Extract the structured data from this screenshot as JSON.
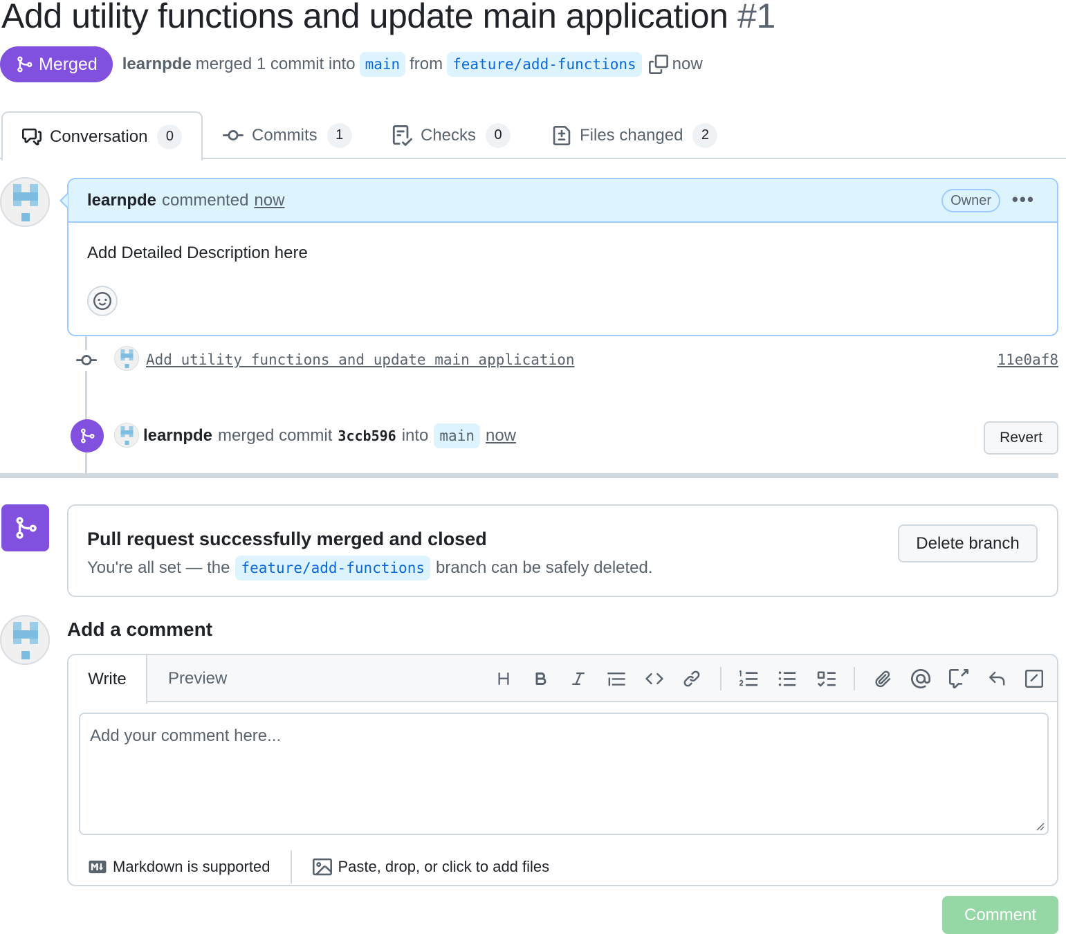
{
  "pr": {
    "title": "Add utility functions and update main application",
    "number": "#1",
    "state": "Merged",
    "author": "learnpde",
    "merged_text": "merged 1 commit into",
    "base_branch": "main",
    "from_text": "from",
    "head_branch": "feature/add-functions",
    "time": "now"
  },
  "tabs": [
    {
      "label": "Conversation",
      "count": "0",
      "icon": "comment-discussion-icon"
    },
    {
      "label": "Commits",
      "count": "1",
      "icon": "git-commit-icon"
    },
    {
      "label": "Checks",
      "count": "0",
      "icon": "checklist-icon"
    },
    {
      "label": "Files changed",
      "count": "2",
      "icon": "file-diff-icon"
    }
  ],
  "comment": {
    "author": "learnpde",
    "action": "commented",
    "time": "now",
    "badge": "Owner",
    "menu": "•••",
    "body": "Add Detailed Description here"
  },
  "commit": {
    "message": "Add utility functions and update main application",
    "sha": "11e0af8"
  },
  "merge_event": {
    "author": "learnpde",
    "text1": "merged commit",
    "sha": "3ccb596",
    "text2": "into",
    "branch": "main",
    "time": "now",
    "revert_label": "Revert"
  },
  "merge_status": {
    "title": "Pull request successfully merged and closed",
    "sub_before": "You're all set — the",
    "branch": "feature/add-functions",
    "sub_after": "branch can be safely deleted.",
    "delete_label": "Delete branch"
  },
  "new_comment": {
    "heading": "Add a comment",
    "write_tab": "Write",
    "preview_tab": "Preview",
    "placeholder": "Add your comment here...",
    "markdown_note": "Markdown is supported",
    "files_note": "Paste, drop, or click to add files",
    "submit_label": "Comment",
    "toolbar": [
      "heading-icon",
      "bold-icon",
      "italic-icon",
      "quote-icon",
      "code-icon",
      "link-icon",
      "ordered-list-icon",
      "unordered-list-icon",
      "task-list-icon",
      "attach-icon",
      "mention-icon",
      "reference-icon",
      "undo-icon",
      "slash-command-icon"
    ]
  },
  "colors": {
    "merged_purple": "#8250df",
    "branch_blue": "#0969da",
    "branch_bg": "#ddf4ff",
    "comment_header_bg": "#ddf4ff",
    "comment_button_disabled": "#95d8a6"
  }
}
